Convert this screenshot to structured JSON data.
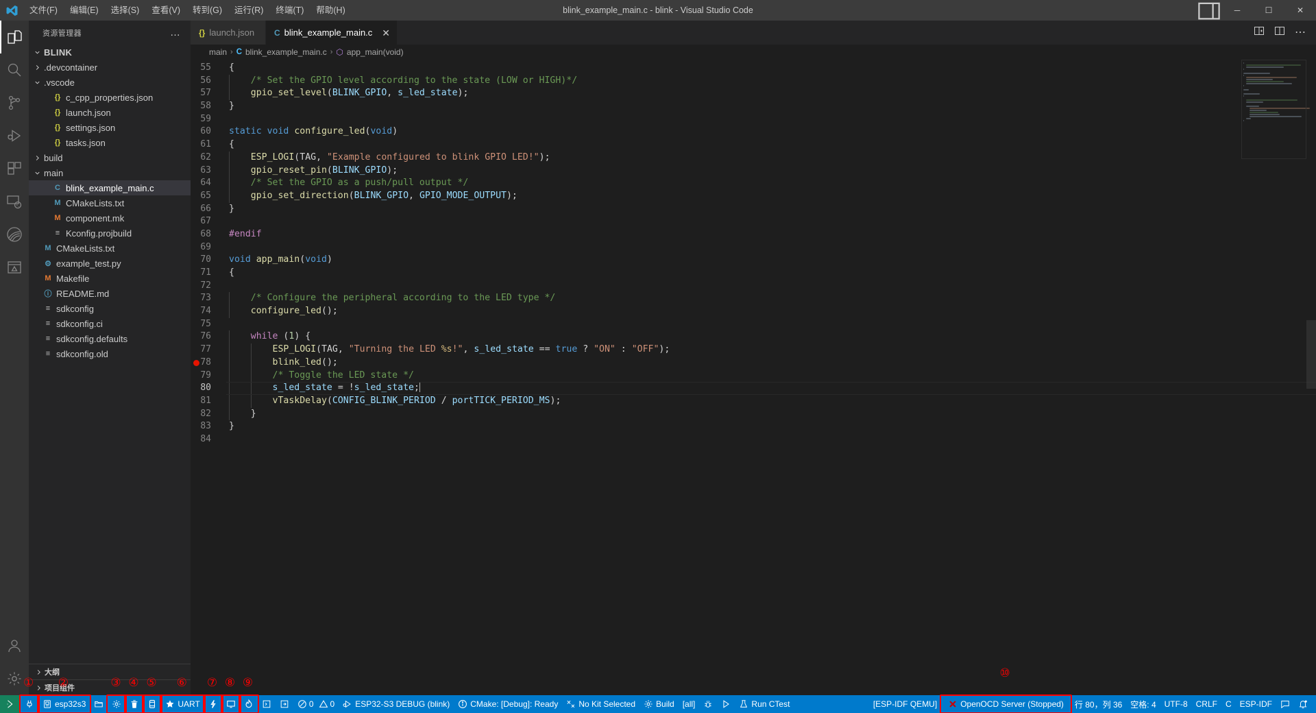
{
  "titlebar": {
    "menus": [
      "文件(F)",
      "编辑(E)",
      "选择(S)",
      "查看(V)",
      "转到(G)",
      "运行(R)",
      "终端(T)",
      "帮助(H)"
    ],
    "title": "blink_example_main.c - blink - Visual Studio Code",
    "minimize": "─",
    "maximize": "☐",
    "close": "✕"
  },
  "activitybar": {
    "items": [
      {
        "name": "explorer-icon",
        "label": "资源管理器"
      },
      {
        "name": "search-icon",
        "label": "搜索"
      },
      {
        "name": "source-control-icon",
        "label": "源代码管理"
      },
      {
        "name": "run-debug-icon",
        "label": "运行和调试"
      },
      {
        "name": "extensions-icon",
        "label": "扩展"
      },
      {
        "name": "remote-explorer-icon",
        "label": "远程资源管理器"
      },
      {
        "name": "espressif-idf-icon",
        "label": "Espressif IDF"
      },
      {
        "name": "testing-icon",
        "label": "测试"
      }
    ],
    "bottom": [
      {
        "name": "accounts-icon",
        "label": "账户"
      },
      {
        "name": "settings-gear-icon",
        "label": "管理"
      }
    ]
  },
  "sidebar": {
    "header": "资源管理器",
    "more": "…",
    "root": "BLINK",
    "tree": [
      {
        "label": ".devcontainer",
        "type": "folder",
        "expanded": false,
        "depth": 1
      },
      {
        "label": ".vscode",
        "type": "folder",
        "expanded": true,
        "depth": 1
      },
      {
        "label": "c_cpp_properties.json",
        "type": "json",
        "depth": 2
      },
      {
        "label": "launch.json",
        "type": "json",
        "depth": 2
      },
      {
        "label": "settings.json",
        "type": "json",
        "depth": 2
      },
      {
        "label": "tasks.json",
        "type": "json",
        "depth": 2
      },
      {
        "label": "build",
        "type": "folder",
        "expanded": false,
        "depth": 1
      },
      {
        "label": "main",
        "type": "folder",
        "expanded": true,
        "depth": 1
      },
      {
        "label": "blink_example_main.c",
        "type": "c",
        "depth": 2,
        "selected": true
      },
      {
        "label": "CMakeLists.txt",
        "type": "cmake",
        "depth": 2
      },
      {
        "label": "component.mk",
        "type": "mk",
        "depth": 2
      },
      {
        "label": "Kconfig.projbuild",
        "type": "text",
        "depth": 2
      },
      {
        "label": "CMakeLists.txt",
        "type": "cmake",
        "depth": 1
      },
      {
        "label": "example_test.py",
        "type": "py",
        "depth": 1
      },
      {
        "label": "Makefile",
        "type": "mk",
        "depth": 1
      },
      {
        "label": "README.md",
        "type": "md",
        "depth": 1
      },
      {
        "label": "sdkconfig",
        "type": "text",
        "depth": 1
      },
      {
        "label": "sdkconfig.ci",
        "type": "text",
        "depth": 1
      },
      {
        "label": "sdkconfig.defaults",
        "type": "text",
        "depth": 1
      },
      {
        "label": "sdkconfig.old",
        "type": "text",
        "depth": 1
      }
    ],
    "panels": [
      {
        "label": "大纲"
      },
      {
        "label": "项目组件"
      }
    ]
  },
  "tabs": [
    {
      "label": "launch.json",
      "icon": "{}",
      "icon_color": "#cbcb41",
      "active": false,
      "closable": false
    },
    {
      "label": "blink_example_main.c",
      "icon": "C",
      "icon_color": "#519aba",
      "active": true,
      "closable": true,
      "close": "✕"
    }
  ],
  "tabbar_actions": [
    {
      "name": "split-editor-icon"
    },
    {
      "name": "open-changes-icon"
    },
    {
      "name": "more-actions-icon"
    }
  ],
  "breadcrumb": {
    "parts": [
      "main",
      "blink_example_main.c",
      "app_main(void)"
    ],
    "separator": "›",
    "file_icon": "C",
    "symbol_icon": "⬡"
  },
  "editor": {
    "first_line": 55,
    "lines": [
      {
        "n": 55,
        "tokens": [
          {
            "t": "{",
            "c": "df"
          }
        ]
      },
      {
        "n": 56,
        "tokens": [
          {
            "t": "    /* Set the GPIO level according to the state (LOW or HIGH)*/",
            "c": "cm"
          }
        ]
      },
      {
        "n": 57,
        "tokens": [
          {
            "t": "    ",
            "c": "df"
          },
          {
            "t": "gpio_set_level",
            "c": "fn"
          },
          {
            "t": "(",
            "c": "df"
          },
          {
            "t": "BLINK_GPIO",
            "c": "va"
          },
          {
            "t": ", ",
            "c": "df"
          },
          {
            "t": "s_led_state",
            "c": "va"
          },
          {
            "t": ");",
            "c": "df"
          }
        ]
      },
      {
        "n": 58,
        "tokens": [
          {
            "t": "}",
            "c": "df"
          }
        ]
      },
      {
        "n": 59,
        "tokens": []
      },
      {
        "n": 60,
        "tokens": [
          {
            "t": "static",
            "c": "k"
          },
          {
            "t": " ",
            "c": "df"
          },
          {
            "t": "void",
            "c": "k"
          },
          {
            "t": " ",
            "c": "df"
          },
          {
            "t": "configure_led",
            "c": "fn"
          },
          {
            "t": "(",
            "c": "df"
          },
          {
            "t": "void",
            "c": "k"
          },
          {
            "t": ")",
            "c": "df"
          }
        ]
      },
      {
        "n": 61,
        "tokens": [
          {
            "t": "{",
            "c": "df"
          }
        ]
      },
      {
        "n": 62,
        "tokens": [
          {
            "t": "    ",
            "c": "df"
          },
          {
            "t": "ESP_LOGI",
            "c": "fn"
          },
          {
            "t": "(",
            "c": "df"
          },
          {
            "t": "TAG",
            "c": "df"
          },
          {
            "t": ", ",
            "c": "df"
          },
          {
            "t": "\"Example configured to blink GPIO LED!\"",
            "c": "st"
          },
          {
            "t": ");",
            "c": "df"
          }
        ]
      },
      {
        "n": 63,
        "tokens": [
          {
            "t": "    ",
            "c": "df"
          },
          {
            "t": "gpio_reset_pin",
            "c": "fn"
          },
          {
            "t": "(",
            "c": "df"
          },
          {
            "t": "BLINK_GPIO",
            "c": "va"
          },
          {
            "t": ");",
            "c": "df"
          }
        ]
      },
      {
        "n": 64,
        "tokens": [
          {
            "t": "    /* Set the GPIO as a push/pull output */",
            "c": "cm"
          }
        ]
      },
      {
        "n": 65,
        "tokens": [
          {
            "t": "    ",
            "c": "df"
          },
          {
            "t": "gpio_set_direction",
            "c": "fn"
          },
          {
            "t": "(",
            "c": "df"
          },
          {
            "t": "BLINK_GPIO",
            "c": "va"
          },
          {
            "t": ", ",
            "c": "df"
          },
          {
            "t": "GPIO_MODE_OUTPUT",
            "c": "va"
          },
          {
            "t": ");",
            "c": "df"
          }
        ]
      },
      {
        "n": 66,
        "tokens": [
          {
            "t": "}",
            "c": "df"
          }
        ]
      },
      {
        "n": 67,
        "tokens": []
      },
      {
        "n": 68,
        "tokens": [
          {
            "t": "#endif",
            "c": "pp"
          }
        ]
      },
      {
        "n": 69,
        "tokens": []
      },
      {
        "n": 70,
        "tokens": [
          {
            "t": "void",
            "c": "k"
          },
          {
            "t": " ",
            "c": "df"
          },
          {
            "t": "app_main",
            "c": "fn"
          },
          {
            "t": "(",
            "c": "df"
          },
          {
            "t": "void",
            "c": "k"
          },
          {
            "t": ")",
            "c": "df"
          }
        ]
      },
      {
        "n": 71,
        "tokens": [
          {
            "t": "{",
            "c": "df"
          }
        ]
      },
      {
        "n": 72,
        "tokens": []
      },
      {
        "n": 73,
        "tokens": [
          {
            "t": "    /* Configure the peripheral according to the LED type */",
            "c": "cm"
          }
        ]
      },
      {
        "n": 74,
        "tokens": [
          {
            "t": "    ",
            "c": "df"
          },
          {
            "t": "configure_led",
            "c": "fn"
          },
          {
            "t": "();",
            "c": "df"
          }
        ]
      },
      {
        "n": 75,
        "tokens": []
      },
      {
        "n": 76,
        "tokens": [
          {
            "t": "    ",
            "c": "df"
          },
          {
            "t": "while",
            "c": "kc"
          },
          {
            "t": " (",
            "c": "df"
          },
          {
            "t": "1",
            "c": "nm"
          },
          {
            "t": ") {",
            "c": "df"
          }
        ]
      },
      {
        "n": 77,
        "tokens": [
          {
            "t": "        ",
            "c": "df"
          },
          {
            "t": "ESP_LOGI",
            "c": "fn"
          },
          {
            "t": "(",
            "c": "df"
          },
          {
            "t": "TAG",
            "c": "df"
          },
          {
            "t": ", ",
            "c": "df"
          },
          {
            "t": "\"Turning the LED ",
            "c": "st"
          },
          {
            "t": "%s",
            "c": "pl"
          },
          {
            "t": "!\"",
            "c": "st"
          },
          {
            "t": ", ",
            "c": "df"
          },
          {
            "t": "s_led_state",
            "c": "va"
          },
          {
            "t": " == ",
            "c": "df"
          },
          {
            "t": "true",
            "c": "k"
          },
          {
            "t": " ? ",
            "c": "df"
          },
          {
            "t": "\"ON\"",
            "c": "st"
          },
          {
            "t": " : ",
            "c": "df"
          },
          {
            "t": "\"OFF\"",
            "c": "st"
          },
          {
            "t": ");",
            "c": "df"
          }
        ]
      },
      {
        "n": 78,
        "breakpoint": true,
        "tokens": [
          {
            "t": "        ",
            "c": "df"
          },
          {
            "t": "blink_led",
            "c": "fn"
          },
          {
            "t": "();",
            "c": "df"
          }
        ]
      },
      {
        "n": 79,
        "tokens": [
          {
            "t": "        /* Toggle the LED state */",
            "c": "cm"
          }
        ]
      },
      {
        "n": 80,
        "current": true,
        "caret": true,
        "tokens": [
          {
            "t": "        ",
            "c": "df"
          },
          {
            "t": "s_led_state",
            "c": "va"
          },
          {
            "t": " = !",
            "c": "df"
          },
          {
            "t": "s_led_state",
            "c": "va"
          },
          {
            "t": ";",
            "c": "df"
          }
        ]
      },
      {
        "n": 81,
        "tokens": [
          {
            "t": "        ",
            "c": "df"
          },
          {
            "t": "vTaskDelay",
            "c": "fn"
          },
          {
            "t": "(",
            "c": "df"
          },
          {
            "t": "CONFIG_BLINK_PERIOD",
            "c": "va"
          },
          {
            "t": " / ",
            "c": "df"
          },
          {
            "t": "portTICK_PERIOD_MS",
            "c": "va"
          },
          {
            "t": ");",
            "c": "df"
          }
        ]
      },
      {
        "n": 82,
        "tokens": [
          {
            "t": "    }",
            "c": "df"
          }
        ]
      },
      {
        "n": 83,
        "tokens": [
          {
            "t": "}",
            "c": "df"
          }
        ]
      },
      {
        "n": 84,
        "tokens": []
      }
    ]
  },
  "statusbar": {
    "left": [
      {
        "name": "remote-indicator",
        "icon": "remote-icon",
        "label": ""
      },
      {
        "name": "esp-idf-flash-method",
        "icon": "plug-icon",
        "label": "",
        "boxed": true,
        "num": "1"
      },
      {
        "name": "esp-idf-target",
        "icon": "chip-icon",
        "label": "esp32s3",
        "boxed": true,
        "num": "2"
      },
      {
        "name": "esp-idf-workspace-folder",
        "icon": "folder-icon",
        "label": ""
      },
      {
        "name": "esp-idf-sdk-configuration-editor",
        "icon": "gear-icon",
        "label": "",
        "boxed": true,
        "num": "3"
      },
      {
        "name": "esp-idf-full-clean",
        "icon": "trash-icon",
        "label": "",
        "boxed": true,
        "num": "4"
      },
      {
        "name": "esp-idf-build",
        "icon": "database-icon",
        "label": "",
        "boxed": true,
        "num": "5"
      },
      {
        "name": "esp-idf-select-port",
        "icon": "star-icon",
        "label": "UART",
        "boxed": true,
        "num": "6"
      },
      {
        "name": "esp-idf-flash-device",
        "icon": "bolt-icon",
        "label": "",
        "boxed": true,
        "num": "7"
      },
      {
        "name": "esp-idf-monitor-device",
        "icon": "monitor-icon",
        "label": "",
        "boxed": true,
        "num": "8"
      },
      {
        "name": "esp-idf-build-flash-monitor",
        "icon": "flame-icon",
        "label": "",
        "boxed": true,
        "num": "9"
      },
      {
        "name": "esp-idf-terminal",
        "icon": "terminal-icon",
        "label": ""
      },
      {
        "name": "esp-idf-open-shell",
        "icon": "export-icon",
        "label": ""
      },
      {
        "name": "problems",
        "icon": "error-warning-icon",
        "label": "0  0",
        "errors": "0",
        "warnings": "0"
      },
      {
        "name": "debug-config",
        "icon": "debug-alt-icon",
        "label": "ESP32-S3 DEBUG (blink)"
      },
      {
        "name": "cmake-status",
        "icon": "info-icon",
        "label": "CMake: [Debug]: Ready"
      },
      {
        "name": "cmake-kit",
        "icon": "tools-icon",
        "label": "No Kit Selected"
      },
      {
        "name": "cmake-build",
        "icon": "gear-icon",
        "label": "Build"
      },
      {
        "name": "cmake-build-target",
        "icon": "",
        "label": "[all]"
      },
      {
        "name": "cmake-debug",
        "icon": "bug-icon",
        "label": ""
      },
      {
        "name": "cmake-launch",
        "icon": "play-icon",
        "label": ""
      },
      {
        "name": "cmake-ctest",
        "icon": "beaker-icon",
        "label": "Run CTest"
      }
    ],
    "right": [
      {
        "name": "esp-idf-qemu",
        "label": "[ESP-IDF QEMU]"
      },
      {
        "name": "openocd-server",
        "icon": "close-x-icon",
        "label": "OpenOCD Server (Stopped)",
        "boxed": true,
        "num": "10"
      },
      {
        "name": "cursor-position",
        "label": "行 80，列 36"
      },
      {
        "name": "indentation",
        "label": "空格: 4"
      },
      {
        "name": "encoding",
        "label": "UTF-8"
      },
      {
        "name": "eol",
        "label": "CRLF"
      },
      {
        "name": "language-mode",
        "label": "C"
      },
      {
        "name": "esp-idf-version",
        "label": "ESP-IDF"
      },
      {
        "name": "feedback-icon",
        "label": ""
      },
      {
        "name": "notifications-bell-icon",
        "label": ""
      }
    ]
  },
  "annotations": {
    "numbers": [
      "1",
      "2",
      "3",
      "4",
      "5",
      "6",
      "7",
      "8",
      "9",
      "10"
    ],
    "color": "#ff0000"
  }
}
